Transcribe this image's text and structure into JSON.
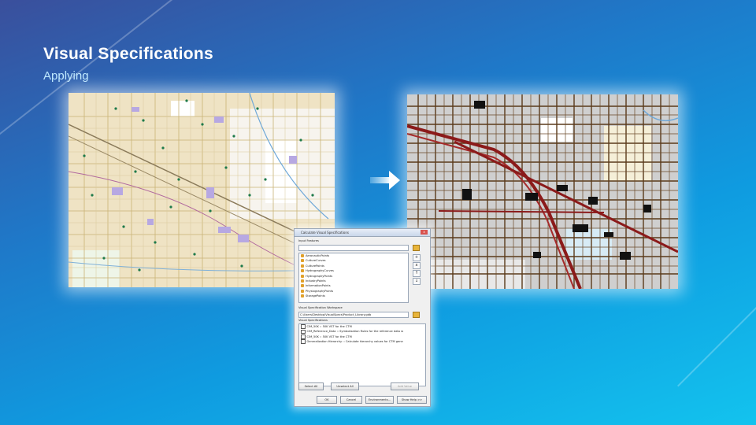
{
  "slide": {
    "title": "Visual Specifications",
    "subtitle": "Applying",
    "background_colors": [
      "#3a4f9c",
      "#1f78c8",
      "#0f9be0",
      "#13c3ee"
    ],
    "title_color": "#ffffff",
    "subtitle_color": "#bfe9ff"
  },
  "icons": {
    "arrow": "right-arrow-icon",
    "folder": "folder-icon",
    "close": "close-icon"
  },
  "maps": {
    "before": {
      "description_icon": "map-image-before"
    },
    "after": {
      "description_icon": "map-image-after"
    }
  },
  "dialog": {
    "title": "Calculate Visual Specifications",
    "close_glyph": "x",
    "input_features_label": "Input Features",
    "input_features_value": "",
    "input_list": [
      "AeronauticPoints",
      "CultureCurves",
      "CulturePoints",
      "HydrographyCurves",
      "HydrographyPoints",
      "IndustryPoints",
      "InformationPoints",
      "PhysiographyPoints",
      "StoragePoints"
    ],
    "side_buttons": [
      "+",
      "x",
      "↑",
      "↓"
    ],
    "workspace_label": "Visual Specification Workspace",
    "workspace_value": "C:\\Users\\Desktop\\VisualSpecs\\Product_Library.gdb",
    "specs_label": "Visual Specifications",
    "specs_list": [
      "CIM_50K :: 50K VST for the CTM",
      "CIM_Reference_Data :: Symbolization Rules for the reference data w",
      "CIM_50K :: 50K VST for the CTM",
      "Generalization Hierarchy :: Calculate hierarchy values for CTM gene"
    ],
    "buttons": {
      "select_all": "Select All",
      "unselect_all": "Unselect All",
      "add_value": "Add Value",
      "ok": "OK",
      "cancel": "Cancel",
      "environments": "Environments...",
      "show_help": "Show Help >>"
    }
  }
}
